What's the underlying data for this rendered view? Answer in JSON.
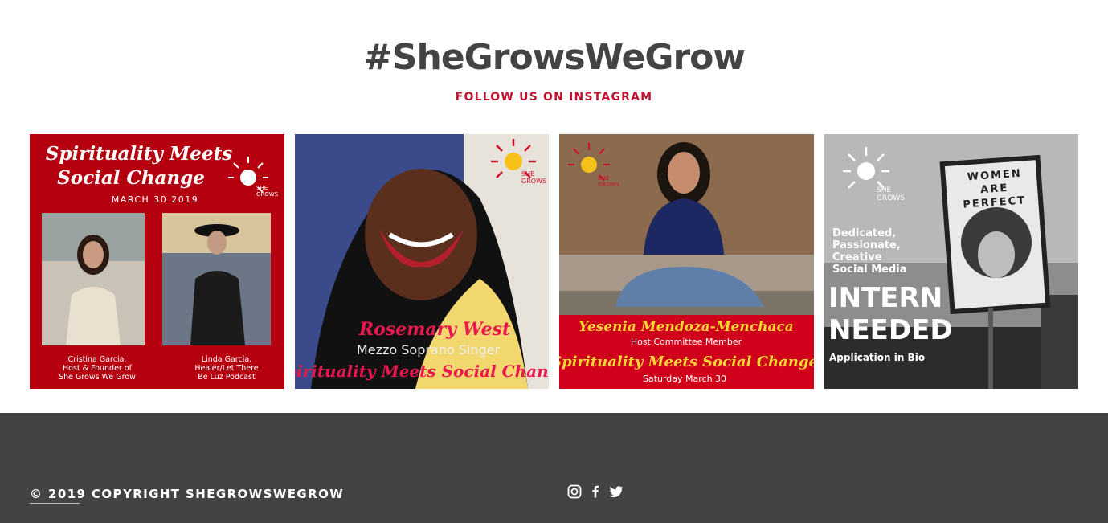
{
  "instagram": {
    "title": "#SheGrowsWeGrow",
    "subtitle": "FOLLOW US ON INSTAGRAM",
    "posts": [
      {
        "headline_1": "Spirituality Meets",
        "headline_2": "Social Change",
        "date": "MARCH 30 2019",
        "person_1": [
          "Cristina Garcia,",
          "Host & Founder of",
          "She Grows We Grow"
        ],
        "person_2": [
          "Linda Garcia,",
          "Healer/Let There",
          "Be Luz Podcast"
        ],
        "logo_text": [
          "SHE",
          "GROWS"
        ]
      },
      {
        "name": "Rosemary West",
        "role": "Mezzo Soprano Singer",
        "tagline": "Spirituality Meets Social Change",
        "logo_text": [
          "SHE",
          "GROWS"
        ]
      },
      {
        "name": "Yesenia Mendoza-Menchaca",
        "role": "Host Committee Member",
        "tagline": "Spirituality Meets Social Change",
        "date": "Saturday March 30",
        "logo_text": [
          "SHE",
          "GROWS"
        ]
      },
      {
        "line_1": "Dedicated,",
        "line_2": "Passionate,",
        "line_3": "Creative",
        "line_4": "Social Media",
        "headline_1": "INTERN",
        "headline_2": "NEEDED",
        "note": "Application in Bio",
        "sign": [
          "WOMEN",
          "ARE",
          "PERFECT"
        ],
        "logo_text": [
          "SHE",
          "GROWS"
        ]
      }
    ]
  },
  "footer": {
    "copyright": "© 2019 COPYRIGHT SHEGROWSWEGROW",
    "social": [
      "instagram-icon",
      "facebook-icon",
      "twitter-icon"
    ]
  },
  "colors": {
    "accent": "#c0132f",
    "footer_bg": "#434343",
    "title": "#444444"
  }
}
